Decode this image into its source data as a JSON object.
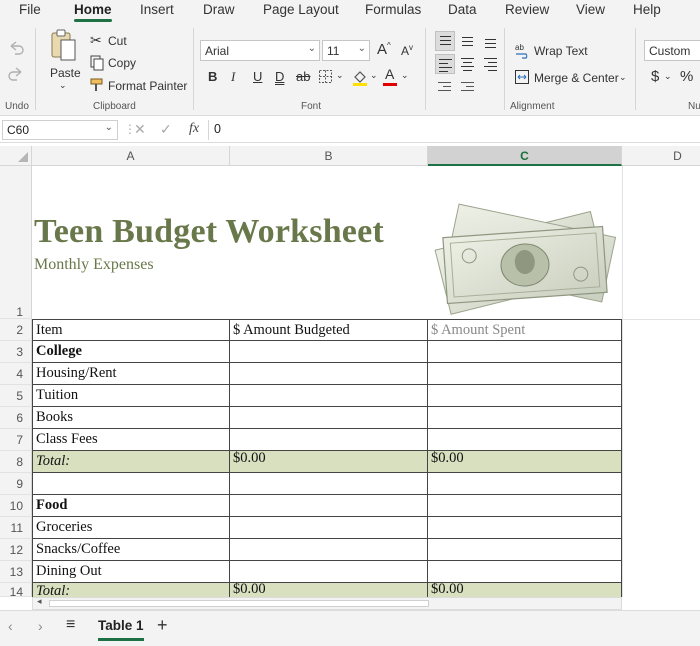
{
  "menu": {
    "items": [
      "File",
      "Home",
      "Insert",
      "Draw",
      "Page Layout",
      "Formulas",
      "Data",
      "Review",
      "View",
      "Help"
    ]
  },
  "ribbon": {
    "undo_group": "Undo",
    "paste_label": "Paste",
    "cut_label": "Cut",
    "copy_label": "Copy",
    "format_painter_label": "Format Painter",
    "clipboard_group": "Clipboard",
    "font_name": "Arial",
    "font_size": "11",
    "bold": "B",
    "italic": "I",
    "underline": "U",
    "double_underline": "D",
    "strike": "ab",
    "font_color_letter": "A",
    "font_group": "Font",
    "wrap_text_label": "Wrap Text",
    "merge_center_label": "Merge & Center",
    "alignment_group": "Alignment",
    "number_format": "Custom",
    "currency": "$",
    "percent": "%",
    "number_group": "Nu",
    "grow_font": "A",
    "shrink_font": "A",
    "fx": "fx"
  },
  "formula_bar": {
    "name_box": "C60",
    "value": "0"
  },
  "columns": [
    "A",
    "B",
    "C",
    "D"
  ],
  "rows": [
    "1",
    "2",
    "3",
    "4",
    "5",
    "6",
    "7",
    "8",
    "9",
    "10",
    "11",
    "12",
    "13",
    "14"
  ],
  "sheet": {
    "title": "Teen Budget Worksheet",
    "subtitle": "Monthly Expenses",
    "header": {
      "a": "Item",
      "b": "$ Amount Budgeted",
      "c": "$ Amount Spent"
    },
    "r3": "College",
    "r4": "Housing/Rent",
    "r5": "Tuition",
    "r6": "Books",
    "r7": "Class Fees",
    "r8": {
      "a": "Total:",
      "b": "$0.00",
      "c": "$0.00"
    },
    "r10": "Food",
    "r11": "Groceries",
    "r12": "Snacks/Coffee",
    "r13": "Dining Out",
    "r14": {
      "a": "Total:",
      "b": "$0.00",
      "c": "$0.00"
    }
  },
  "tabs": {
    "active": "Table 1",
    "add": "+"
  },
  "colors": {
    "accent": "#1e7145",
    "title_green": "#68784a",
    "total_fill": "#d8e0c0"
  }
}
